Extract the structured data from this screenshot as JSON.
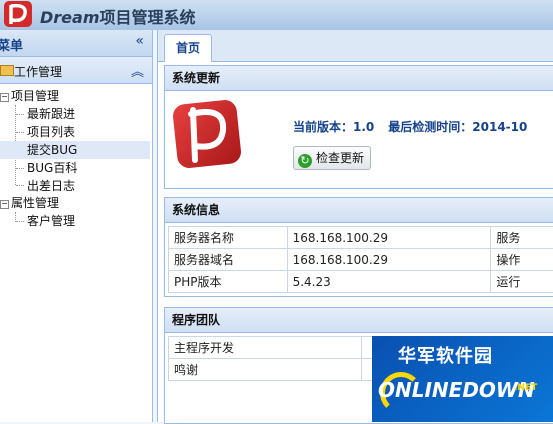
{
  "header": {
    "title_en": "Dream",
    "title_cn": "项目管理系统"
  },
  "sidebar": {
    "head_label": "菜单",
    "collapse_glyph": "«",
    "panel_label": "工作管理",
    "panel_toggle_glyph": "︽",
    "tree": {
      "group1": "项目管理",
      "group1_items": [
        "最新跟进",
        "项目列表",
        "提交BUG",
        "BUG百科",
        "出差日志"
      ],
      "group2": "属性管理",
      "group2_items": [
        "客户管理"
      ]
    }
  },
  "tabs": [
    {
      "label": "首页"
    }
  ],
  "update_panel": {
    "title": "系统更新",
    "version_label": "当前版本：1.0",
    "last_check_label": "最后检测时间：2014-10",
    "check_button": "检查更新"
  },
  "info_panel": {
    "title": "系统信息",
    "rows": [
      {
        "label": "服务器名称",
        "value": "168.168.100.29",
        "extra": "服务"
      },
      {
        "label": "服务器域名",
        "value": "168.168.100.29",
        "extra": "操作"
      },
      {
        "label": "PHP版本",
        "value": "5.4.23",
        "extra": "运行"
      }
    ]
  },
  "team_panel": {
    "title": "程序团队",
    "rows": [
      {
        "label": "主程序开发",
        "value": ""
      },
      {
        "label": "鸣谢",
        "value": ""
      }
    ]
  },
  "watermark": {
    "cn": "华军软件园",
    "en": "ONLINEDOWN",
    "net": ".NET"
  },
  "colors": {
    "accent": "#15428b",
    "border": "#99bbe8",
    "logo_red": "#d42a2a"
  },
  "icons": [
    "dream-logo-icon",
    "collapse-icon",
    "folder-icon",
    "refresh-icon"
  ]
}
